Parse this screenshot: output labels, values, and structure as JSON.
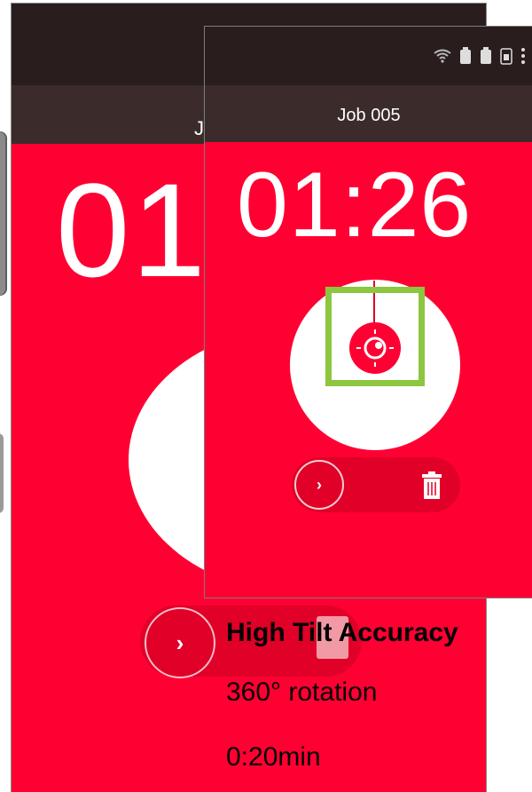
{
  "back_screen": {
    "title": "J",
    "timer": "01"
  },
  "front_screen": {
    "title": "Job 005",
    "timer": "01:26",
    "icons": {
      "wifi": "wifi-icon",
      "battery1": "battery-icon",
      "battery2": "battery-icon",
      "sd": "sd-card-icon",
      "menu": "more-vert-icon"
    }
  },
  "captions": {
    "headline": "High Tilt Accuracy",
    "rotation": "360° rotation",
    "duration": "0:20min"
  },
  "colors": {
    "accent": "#ff0033",
    "dark": "#2a1d1d",
    "highlight": "#8dc63f",
    "white": "#ffffff"
  }
}
